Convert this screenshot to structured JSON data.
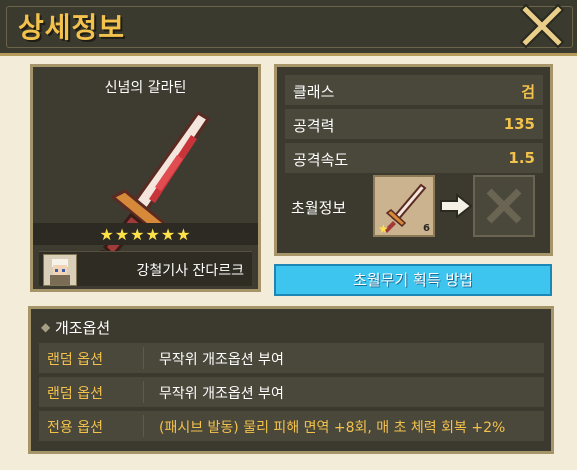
{
  "window": {
    "title": "상세정보",
    "close_icon": "close-x-icon"
  },
  "item": {
    "name": "신념의 갈라틴",
    "stars": "★★★★★★",
    "owner": "강철기사 잔다르크",
    "icon": "sword-icon"
  },
  "stats": [
    {
      "label": "클래스",
      "value": "검"
    },
    {
      "label": "공격력",
      "value": "135"
    },
    {
      "label": "공격속도",
      "value": "1.5"
    }
  ],
  "transcend": {
    "label": "초월정보",
    "slot_level": "6",
    "arrow_icon": "pointing-hand-icon",
    "target_icon": "locked-x-icon"
  },
  "get_button": "초월무기 획득 방법",
  "options": {
    "title": "개조옵션",
    "rows": [
      {
        "tag": "랜덤 옵션",
        "desc": "무작위 개조옵션 부여",
        "special": false
      },
      {
        "tag": "랜덤 옵션",
        "desc": "무작위 개조옵션 부여",
        "special": false
      },
      {
        "tag": "전용 옵션",
        "desc": "(패시브 발동) 물리 피해 면역 +8회, 매 초 체력 회복 +2%",
        "special": true
      }
    ]
  },
  "colors": {
    "accent": "#f2c24c",
    "button": "#3ec5ef",
    "panel": "#3c3a2f",
    "frame": "#f3ecd9"
  }
}
